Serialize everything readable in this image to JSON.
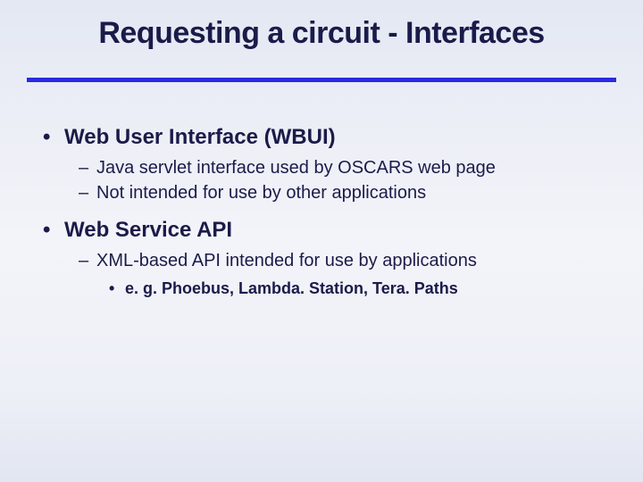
{
  "title": "Requesting a circuit - Interfaces",
  "bullets": [
    {
      "label": "Web User Interface (WBUI)",
      "sub": [
        {
          "label": "Java servlet interface used by OSCARS web page"
        },
        {
          "label": "Not intended for use by other applications"
        }
      ]
    },
    {
      "label": "Web Service API",
      "sub": [
        {
          "label": "XML-based API intended for use by applications",
          "sub": [
            {
              "label": "e. g. Phoebus, Lambda. Station, Tera. Paths"
            }
          ]
        }
      ]
    }
  ]
}
